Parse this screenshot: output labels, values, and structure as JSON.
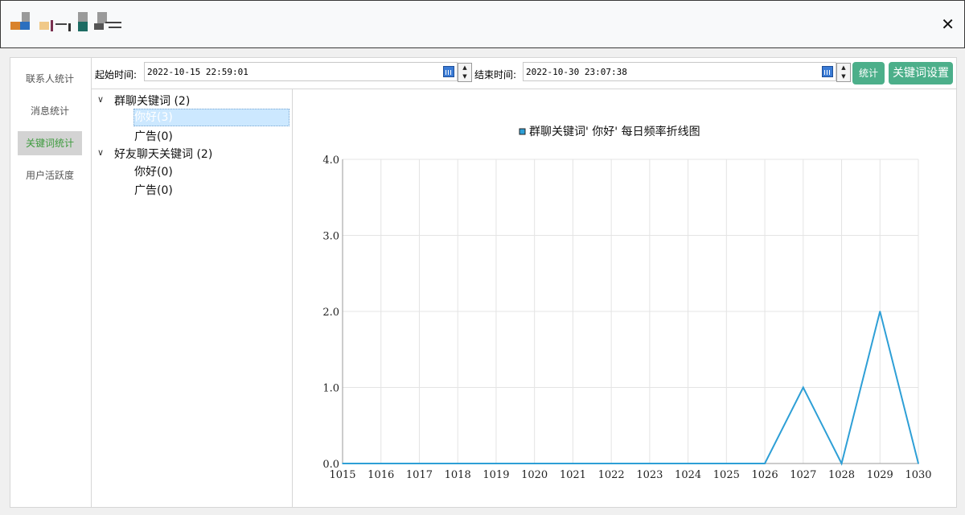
{
  "window": {
    "close_symbol": "✕"
  },
  "sidenav": {
    "items": [
      {
        "label": "联系人统计",
        "active": false
      },
      {
        "label": "消息统计",
        "active": false
      },
      {
        "label": "关键词统计",
        "active": true
      },
      {
        "label": "用户活跃度",
        "active": false
      }
    ]
  },
  "toolbar": {
    "start_label": "起始时间:",
    "start_value": "2022-10-15 22:59:01",
    "end_label": "结束时间:",
    "end_value": "2022-10-30 23:07:38",
    "stat_button": "统计",
    "keyword_settings_button": "关键词设置"
  },
  "tree": {
    "groups": [
      {
        "label": "群聊关键词 (2)",
        "children": [
          "你好(3)",
          "广告(0)"
        ]
      },
      {
        "label": "好友聊天关键词 (2)",
        "children": [
          "你好(0)",
          "广告(0)"
        ]
      }
    ]
  },
  "chart_data": {
    "type": "line",
    "legend": "群聊关键词' 你好' 每日频率折线图",
    "legend_position": "top-center",
    "series": [
      {
        "name": "群聊关键词' 你好' 每日频率折线图",
        "color": "#2e9fd6",
        "x": [
          "1015",
          "1016",
          "1017",
          "1018",
          "1019",
          "1020",
          "1021",
          "1022",
          "1023",
          "1024",
          "1025",
          "1026",
          "1027",
          "1028",
          "1029",
          "1030"
        ],
        "values": [
          0,
          0,
          0,
          0,
          0,
          0,
          0,
          0,
          0,
          0,
          0,
          0,
          1,
          0,
          2,
          0
        ]
      }
    ],
    "ylim": [
      0,
      4
    ],
    "yticks": [
      "0.0",
      "1.0",
      "2.0",
      "3.0",
      "4.0"
    ],
    "grid": true
  }
}
